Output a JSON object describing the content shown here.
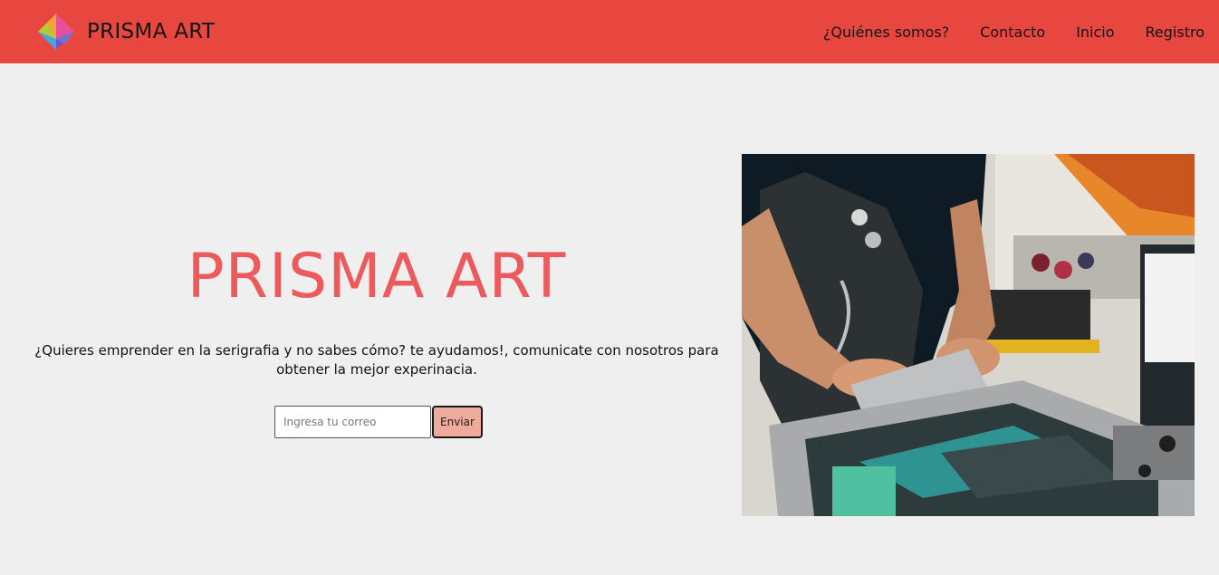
{
  "brand": {
    "name": "PRISMA ART",
    "logo_icon": "prism-logo-icon"
  },
  "nav": {
    "items": [
      {
        "label": "¿Quiénes somos?"
      },
      {
        "label": "Contacto"
      },
      {
        "label": "Inicio"
      },
      {
        "label": "Registro"
      }
    ]
  },
  "hero": {
    "title": "PRISMA ART",
    "description": "¿Quieres emprender en la serigrafia y no sabes cómo? te ayudamos!, comunicate con nosotros para obtener la mejor experinacia.",
    "email_placeholder": "Ingresa tu correo",
    "email_value": "",
    "submit_label": "Enviar",
    "image_icon": "screen-printing-photo"
  },
  "colors": {
    "navbar": "#e84740",
    "page_background": "#efefef",
    "title": "#ec5a5c",
    "button": "#eeaa9a"
  }
}
